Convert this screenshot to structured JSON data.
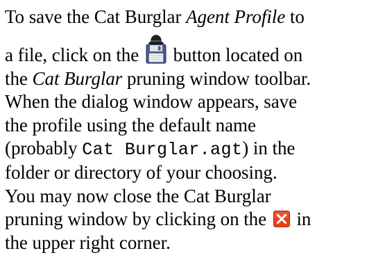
{
  "document": {
    "lines": {
      "l1_a": "To save the Cat Burglar ",
      "l1_em": "Agent Profile",
      "l1_b": " to",
      "l2_a": "a file, click on the ",
      "l2_b": " button located on",
      "l3_a": "the ",
      "l3_em": "Cat Burglar",
      "l3_b": " pruning window toolbar.",
      "l4": "When the dialog window appears, save",
      "l5": "the profile using the default name",
      "l6_a": "(probably ",
      "l6_code": "Cat Burglar.agt",
      "l6_b": ") in the",
      "l7": "folder or directory of your choosing.",
      "l8": "You may now close the Cat Burglar",
      "l9_a": "pruning window by clicking on the ",
      "l9_b": " in",
      "l10": "the upper right corner."
    },
    "icons": {
      "save_icon": "cat-burglar-save-icon",
      "close_icon": "close-window-icon",
      "close_color": "#e8401c"
    }
  }
}
